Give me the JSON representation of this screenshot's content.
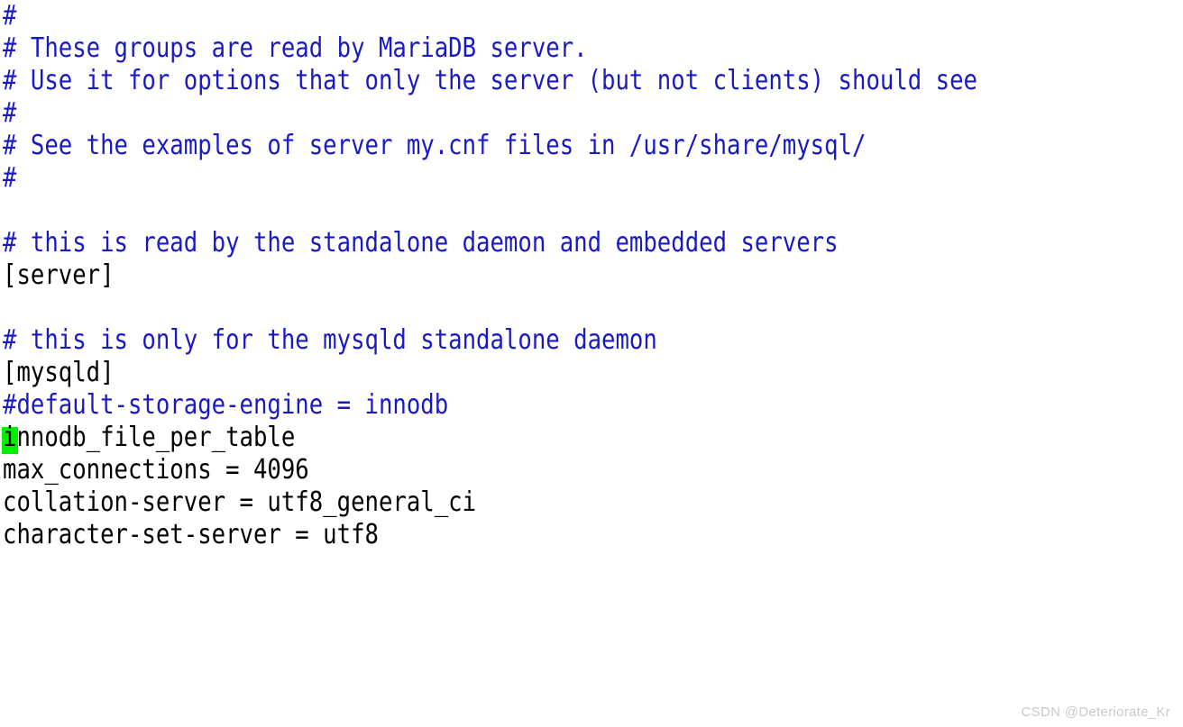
{
  "editor": {
    "kind": "terminal-text-editor",
    "background_color": "#ffffff",
    "comment_color": "#1a1ac4",
    "text_color": "#000000",
    "cursor_color": "#00f000",
    "font_px": 30,
    "line_height_px": 36,
    "lines": [
      {
        "text": "#",
        "style": "comment"
      },
      {
        "text": "# These groups are read by MariaDB server.",
        "style": "comment"
      },
      {
        "text": "# Use it for options that only the server (but not clients) should see",
        "style": "comment"
      },
      {
        "text": "#",
        "style": "comment"
      },
      {
        "text": "# See the examples of server my.cnf files in /usr/share/mysql/",
        "style": "comment"
      },
      {
        "text": "#",
        "style": "comment"
      },
      {
        "text": "",
        "style": "blank"
      },
      {
        "text": "# this is read by the standalone daemon and embedded servers",
        "style": "comment"
      },
      {
        "text": "[server]",
        "style": "plain"
      },
      {
        "text": "",
        "style": "blank"
      },
      {
        "text": "# this is only for the mysqld standalone daemon",
        "style": "comment"
      },
      {
        "text": "[mysqld]",
        "style": "plain"
      },
      {
        "text": "#default-storage-engine = innodb",
        "style": "comment"
      },
      {
        "text": "innodb_file_per_table",
        "style": "plain"
      },
      {
        "text": "max_connections = 4096",
        "style": "plain"
      },
      {
        "text": "collation-server = utf8_general_ci",
        "style": "plain"
      },
      {
        "text": "character-set-server = utf8",
        "style": "plain"
      }
    ]
  },
  "cursor": {
    "line_index": 13,
    "column_index": 0,
    "char": "i",
    "block_color": "#00f000",
    "char_color": "#000000"
  },
  "watermark": {
    "text": "CSDN @Deteriorate_Kr",
    "color": "#c9c9c9"
  }
}
